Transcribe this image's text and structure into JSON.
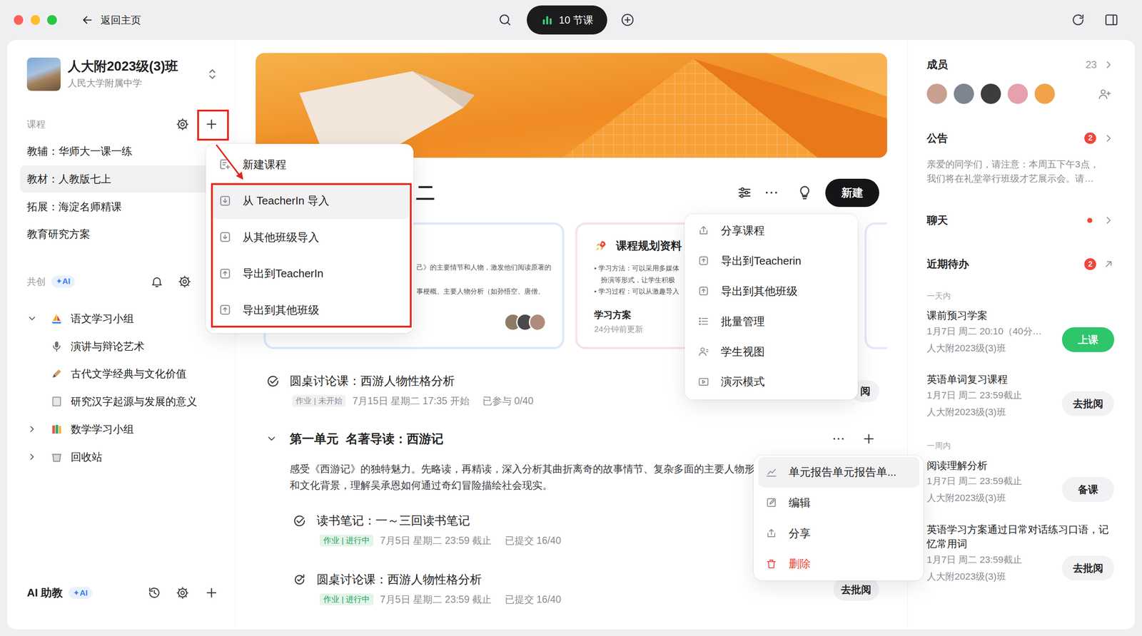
{
  "window": {
    "back_label": "返回主页",
    "lessons": "10 节课"
  },
  "class_header": {
    "title": "人大附2023级(3)班",
    "school": "人民大学附属中学"
  },
  "sidebar": {
    "courses_label": "课程",
    "courses": [
      {
        "label": "教辅：华师大一课一练",
        "selected": false
      },
      {
        "label": "教材：人教版七上",
        "selected": true
      },
      {
        "label": "拓展：海淀名师精课",
        "selected": false
      },
      {
        "label": "教育研究方案",
        "selected": false
      }
    ],
    "cocreate": {
      "label": "共创",
      "badge": "✦AI"
    },
    "groups": [
      {
        "label": "语文学习小组",
        "expanded": true,
        "children": [
          "演讲与辩论艺术",
          "古代文学经典与文化价值",
          "研究汉字起源与发展的意义"
        ]
      },
      {
        "label": "数学学习小组",
        "expanded": false,
        "children": []
      },
      {
        "label": "回收站",
        "expanded": false,
        "children": []
      }
    ],
    "assistant": {
      "label": "AI 助教",
      "badge": "✦AI"
    }
  },
  "add_menu": [
    {
      "label": "新建课程",
      "highlighted": false
    },
    {
      "label": "从 TeacherIn 导入",
      "highlighted": true
    },
    {
      "label": "从其他班级导入",
      "highlighted": false
    },
    {
      "label": "导出到TeacherIn",
      "highlighted": false
    },
    {
      "label": "导出到其他班级",
      "highlighted": false
    }
  ],
  "main": {
    "title": "二",
    "new_button": "新建",
    "cards": [
      {
        "kind": "brief",
        "lines": [
          "己》的主要情节和人物，激发他们阅读原著的",
          "事梗概、主要人物分析（如孙悟空、唐僧、"
        ],
        "avatars": [
          {
            "color": "#8f7a66"
          },
          {
            "color": "#4a4a4a"
          },
          {
            "color": "#b08a7a"
          }
        ]
      },
      {
        "kind": "plan",
        "title": "课程规划资料",
        "bullets": [
          "• 学习方法：可以采用多媒体",
          "扮演等形式，让学生积极",
          "• 学习过程：可以从激趣导入"
        ],
        "name": "学习方案",
        "updated": "24分钟前更新"
      },
      {
        "kind": "stub"
      }
    ],
    "top_item": {
      "title": "圆桌讨论课：西游人物性格分析",
      "tag": "作业 | 未开始",
      "tag_color": "#8a8f98",
      "time": "7月15日 星期二 17:35 开始",
      "progress": "已参与 0/40",
      "action": "阅"
    },
    "unit": {
      "expanded": true,
      "title": "第一单元  名著导读：西游记",
      "description": [
        "感受《西游记》的独特魅力。先略读，再精读，深入分析其曲折离奇的故事情节、复杂多面的主要人物形",
        "和文化背景，理解吴承恩如何通过奇幻冒险描绘社会现实。"
      ],
      "items": [
        {
          "title": "读书笔记：一～三回读书笔记",
          "tag": "作业 | 进行中",
          "tag_color": "#22a55a",
          "time": "7月5日 星期二 23:59 截止",
          "progress": "已提交 16/40"
        },
        {
          "title": "圆桌讨论课：西游人物性格分析",
          "tag": "作业 | 进行中",
          "tag_color": "#22a55a",
          "time": "7月5日 星期二 23:59 截止",
          "progress": "已提交 16/40",
          "action": "去批阅"
        }
      ]
    }
  },
  "course_menu": [
    "分享课程",
    "导出到Teacherin",
    "导出到其他班级",
    "批量管理",
    "学生视图",
    "演示模式"
  ],
  "unit_menu": [
    {
      "label": "单元报告单元报告单...",
      "highlighted": true,
      "danger": false
    },
    {
      "label": "编辑",
      "highlighted": false,
      "danger": false
    },
    {
      "label": "分享",
      "highlighted": false,
      "danger": false
    },
    {
      "label": "删除",
      "highlighted": false,
      "danger": true
    }
  ],
  "right": {
    "members": {
      "label": "成员",
      "count": "23",
      "avatars": [
        {
          "color": "#c9a08f"
        },
        {
          "color": "#7d8590"
        },
        {
          "color": "#3d3d3d"
        },
        {
          "color": "#e6a0ae"
        },
        {
          "color": "#f0a34a"
        }
      ]
    },
    "notice": {
      "label": "公告",
      "badge": "2",
      "lines": [
        "亲爱的同学们，请注意：本周五下午3点，",
        "我们将在礼堂举行班级才艺展示会。请…"
      ]
    },
    "chat": {
      "label": "聊天",
      "unread": true
    },
    "todo": {
      "label": "近期待办",
      "badge": "2",
      "groups": [
        {
          "label": "一天内",
          "items": [
            {
              "title": "课前预习学案",
              "due": "1月7日 周二 20:10（40分…",
              "class": "人大附2023级(3)班",
              "action": "上课",
              "primary": true
            },
            {
              "title": "英语单词复习课程",
              "due": "1月7日 周二 23:59截止",
              "class": "人大附2023级(3)班",
              "action": "去批阅",
              "primary": false
            }
          ]
        },
        {
          "label": "一周内",
          "items": [
            {
              "title": "阅读理解分析",
              "due": "1月7日 周二 23:59截止",
              "class": "人大附2023级(3)班",
              "action": "备课",
              "primary": false
            },
            {
              "title": "英语学习方案通过日常对话练习口语，记忆常用词",
              "due": "1月7日 周二 23:59截止",
              "class": "人大附2023级(3)班",
              "action": "去批阅",
              "primary": false
            }
          ]
        }
      ]
    }
  }
}
